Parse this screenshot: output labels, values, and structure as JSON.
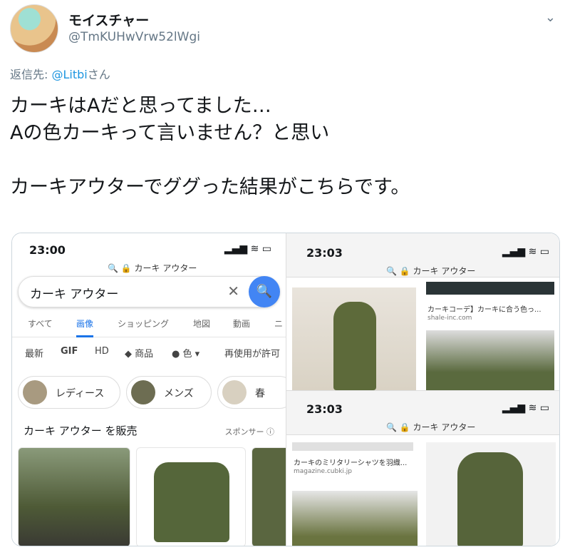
{
  "author": {
    "name": "モイスチャー",
    "handle": "@TmKUHwVrw52lWgi"
  },
  "reply": {
    "prefix": "返信先: ",
    "mention": "@Litbi",
    "suffix": "さん"
  },
  "tweet_text": "カーキはAだと思ってました…\nAの色カーキって言いません？と思い\n\nカーキアウターでググった結果がこちらです。",
  "left_phone": {
    "time": "23:00",
    "status_icons": "▂▄▆ ≋ ▭",
    "address": "🔍 🔒 カーキ アウター",
    "search_value": "カーキ アウター",
    "clear_icon": "✕",
    "search_btn": "🔍",
    "tabs": [
      "すべて",
      "画像",
      "ショッピング",
      "地図",
      "動画",
      "ニ"
    ],
    "filters": [
      "最新",
      "GIF",
      "HD",
      "◆ 商品",
      "● 色 ▾",
      "再使用が許可"
    ],
    "chips": [
      "レディース",
      "メンズ",
      "春"
    ],
    "shop_title": "カーキ アウター を販売",
    "sponsor": "スポンサー ⓘ"
  },
  "right_top": {
    "time": "23:03",
    "status_icons": "▂▄▆ ≋ ▭",
    "address": "🔍 🔒 カーキ アウター",
    "caption": "カーキコーデ】カーキに合う色っ...",
    "source": "shale-inc.com"
  },
  "right_bottom": {
    "time": "23:03",
    "status_icons": "▂▄▆ ≋ ▭",
    "address": "🔍 🔒 カーキ アウター",
    "caption": "カーキのミリタリーシャツを羽織...",
    "source": "magazine.cubki.jp"
  },
  "icons": {
    "chevron": "chevron-down-icon"
  },
  "colors": {
    "link": "#1b95e0",
    "google_blue": "#4285f4",
    "khaki": "#5f6b3a"
  }
}
